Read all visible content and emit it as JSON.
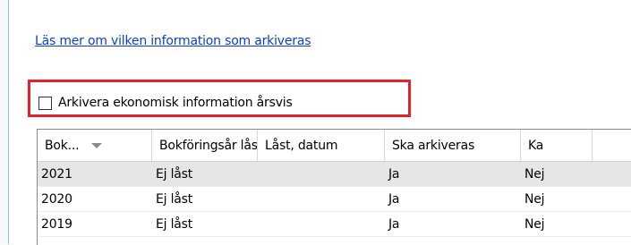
{
  "link": {
    "text": "Läs mer om vilken information som arkiveras"
  },
  "archive_option": {
    "label": "Arkivera ekonomisk information årsvis",
    "checked": false
  },
  "grid": {
    "columns": [
      "Bok...",
      "Bokföringsår låst",
      "Låst, datum",
      "Ska arkiveras",
      "Ka"
    ],
    "rows": [
      {
        "year": "2021",
        "locked": "Ej låst",
        "date": "",
        "archive": "Ja",
        "extra": "Nej"
      },
      {
        "year": "2020",
        "locked": "Ej låst",
        "date": "",
        "archive": "Ja",
        "extra": "Nej"
      },
      {
        "year": "2019",
        "locked": "Ej låst",
        "date": "",
        "archive": "Ja",
        "extra": "Nej"
      }
    ]
  },
  "colors": {
    "highlight": "#e2232a",
    "link": "#0b3fc5",
    "selected_row": "#e6e6e6"
  }
}
